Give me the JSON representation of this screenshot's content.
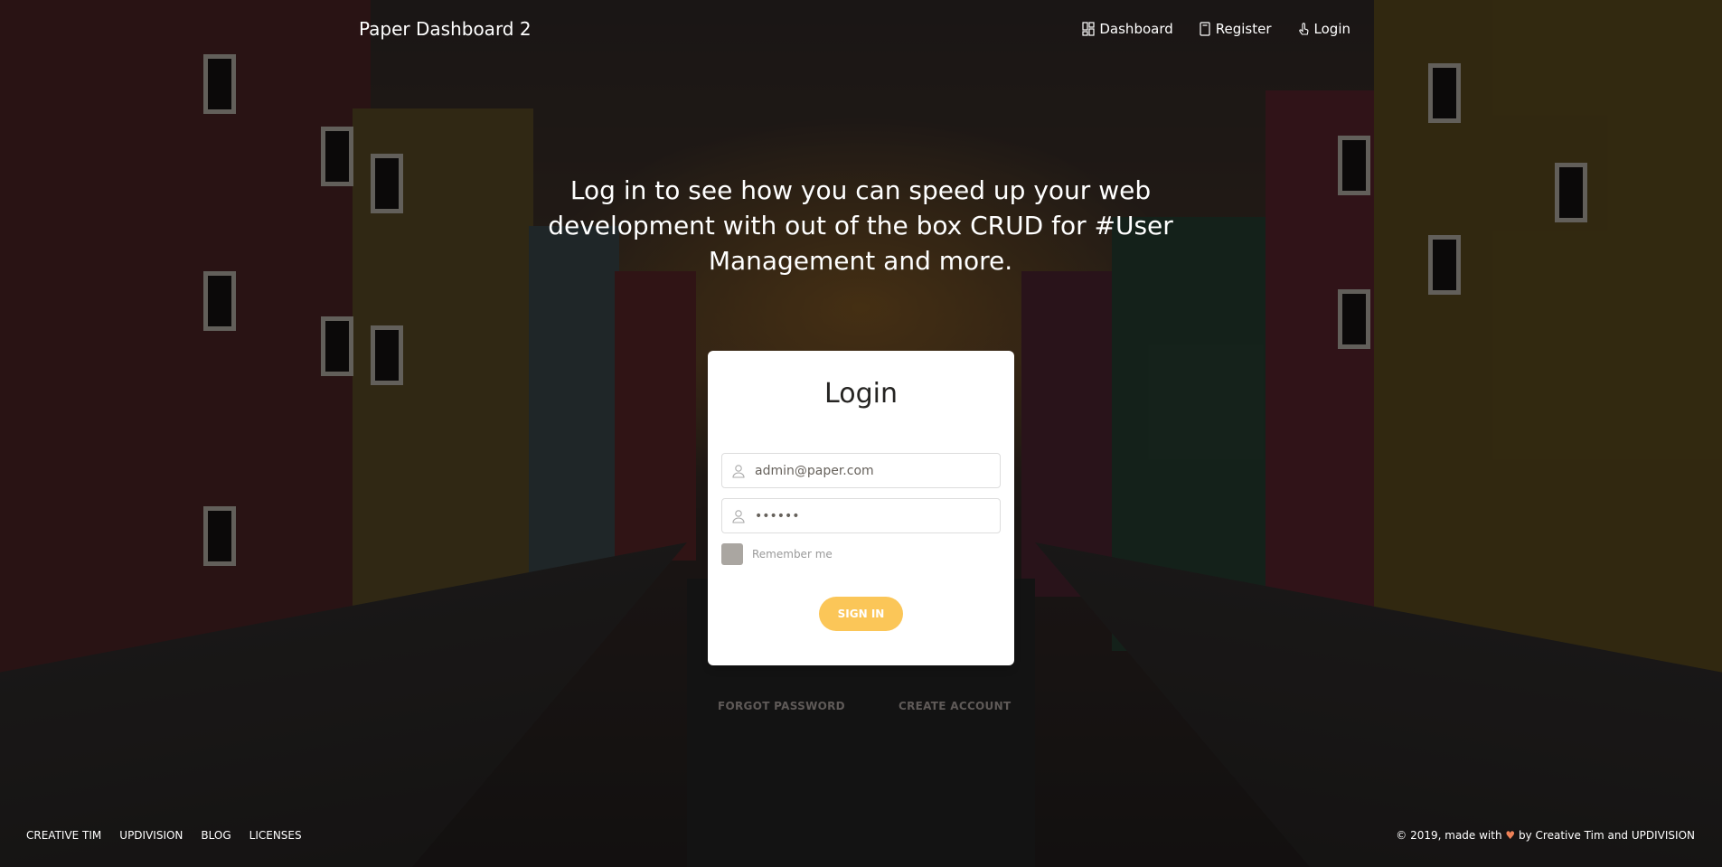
{
  "navbar": {
    "brand": "Paper Dashboard 2",
    "links": [
      {
        "label": "Dashboard",
        "icon": "dashboard-icon"
      },
      {
        "label": "Register",
        "icon": "book-icon"
      },
      {
        "label": "Login",
        "icon": "tap-icon"
      }
    ]
  },
  "hero": {
    "text": "Log in to see how you can speed up your web development with out of the box CRUD for #User Management and more."
  },
  "login_card": {
    "title": "Login",
    "email_value": "admin@paper.com",
    "password_value": "••••••",
    "remember_label": "Remember me",
    "remember_checked": false,
    "submit_label": "SIGN IN",
    "accent_color": "#fbc658"
  },
  "links": {
    "forgot": "FORGOT PASSWORD",
    "create": "CREATE ACCOUNT"
  },
  "footer": {
    "links": [
      "CREATIVE TIM",
      "UPDIVISION",
      "BLOG",
      "LICENSES"
    ],
    "copyright_prefix": "© 2019, made with",
    "heart": "♥",
    "copyright_suffix": "by Creative Tim and UPDIVISION"
  }
}
